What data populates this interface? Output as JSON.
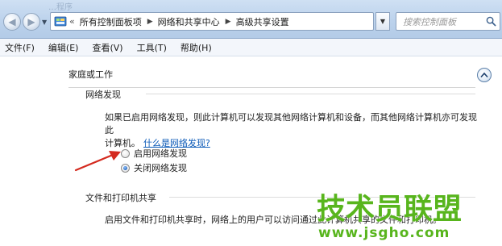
{
  "window": {
    "ghost_title": "…程序"
  },
  "address_bar": {
    "chevron": "«",
    "breadcrumbs": [
      "所有控制面板项",
      "网络和共享中心",
      "高级共享设置"
    ]
  },
  "search": {
    "placeholder": "搜索控制面板"
  },
  "menu": {
    "items": [
      "文件(F)",
      "编辑(E)",
      "查看(V)",
      "工具(T)",
      "帮助(H)"
    ]
  },
  "settings": {
    "profile_title": "家庭或工作",
    "network_discovery": {
      "heading": "网络发现",
      "description_line1": "如果已启用网络发现，则此计算机可以发现其他网络计算机和设备，而其他网络计算机亦可发现此",
      "description_line2": "计算机。",
      "help_link": "什么是网络发现?",
      "options": [
        {
          "label": "启用网络发现",
          "checked": false
        },
        {
          "label": "关闭网络发现",
          "checked": true
        }
      ]
    },
    "file_sharing": {
      "heading": "文件和打印机共享",
      "description": "启用文件和打印机共享时，网络上的用户可以访问通过此计算机共享的文件和打印机。"
    }
  },
  "watermark": {
    "title": "技术员联盟",
    "url": "www.jsgho.com"
  },
  "colors": {
    "accent_link": "#0d5bb8",
    "arrow": "#d42a1f",
    "watermark": "#58b51d"
  }
}
